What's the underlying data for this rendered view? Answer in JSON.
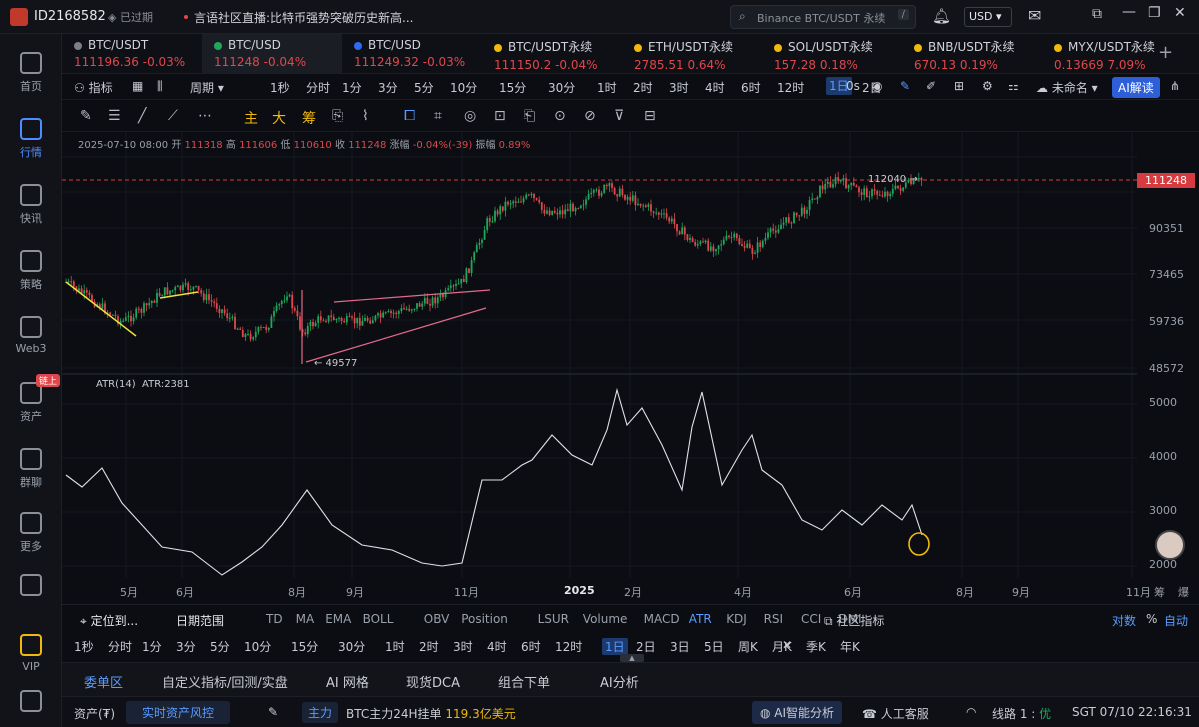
{
  "topbar": {
    "account": "ID2168582",
    "expired": "已过期",
    "news_prefix": "言语社区直播:",
    "news": "比特币强势突破历史新高...",
    "search_placeholder": "Binance BTC/USDT 永续",
    "search_key": "/",
    "currency": "USD"
  },
  "sidebar": [
    {
      "label": "首页",
      "icon": "home-icon"
    },
    {
      "label": "行情",
      "icon": "market-chart-icon",
      "active": true
    },
    {
      "label": "快讯",
      "icon": "news-icon"
    },
    {
      "label": "策略",
      "icon": "robot-icon"
    },
    {
      "label": "Web3",
      "icon": "web3-icon"
    },
    {
      "label": "资产",
      "icon": "wallet-icon",
      "badge": "链上"
    },
    {
      "label": "群聊",
      "icon": "chat-icon"
    },
    {
      "label": "更多",
      "icon": "more-grid-icon"
    },
    {
      "label": "",
      "icon": "phone-icon"
    },
    {
      "label": "VIP",
      "icon": "vip-icon"
    },
    {
      "label": "",
      "icon": "settings-icon"
    }
  ],
  "tickers": [
    {
      "name": "BTC/USDT",
      "price": "111196.36",
      "change": "-0.03%",
      "color": "#7a7f8a"
    },
    {
      "name": "BTC/USD",
      "price": "111248",
      "change": "-0.04%",
      "color": "#1fa85c",
      "active": true
    },
    {
      "name": "BTC/USD",
      "price": "111249.32",
      "change": "-0.03%",
      "color": "#2c6cf0"
    },
    {
      "name": "BTC/USDT永续",
      "price": "111150.2",
      "change": "-0.04%",
      "color": "#f0b90b"
    },
    {
      "name": "ETH/USDT永续",
      "price": "2785.51",
      "change": "0.64%",
      "color": "#f0b90b"
    },
    {
      "name": "SOL/USDT永续",
      "price": "157.28",
      "change": "0.18%",
      "color": "#f0b90b"
    },
    {
      "name": "BNB/USDT永续",
      "price": "670.13",
      "change": "0.19%",
      "color": "#f0b90b"
    },
    {
      "name": "MYX/USDT永续",
      "price": "0.13669",
      "change": "7.09%",
      "color": "#f0b90b"
    }
  ],
  "toolbar1": {
    "indicator": "指标",
    "period": "周期",
    "intervals": [
      "1秒",
      "分时",
      "1分",
      "3分",
      "5分",
      "10分",
      "15分",
      "30分",
      "1时",
      "2时",
      "3时",
      "4时",
      "6时",
      "12时",
      "1日",
      "2日"
    ],
    "active_interval": "1日",
    "seconds": "0s",
    "layout_name": "未命名",
    "ai_label": "AI解读"
  },
  "toolbar2": {
    "labels": [
      "主",
      "大",
      "筹"
    ]
  },
  "ohlc": {
    "date": "2025-07-10 08:00",
    "open_label": "开",
    "open": "111318",
    "high_label": "高",
    "high": "111606",
    "low_label": "低",
    "low": "110610",
    "close_label": "收",
    "close": "111248",
    "chg_label": "涨幅",
    "chg": "-0.04%(-39)",
    "amp_label": "振幅",
    "amp": "0.89%"
  },
  "price_axis": {
    "ticks": [
      "90351",
      "73465",
      "59736",
      "48572"
    ],
    "current": "111248",
    "high_marker": "112040",
    "low_marker": "49577"
  },
  "atr": {
    "title": "ATR(14)",
    "value_label": "ATR:2381",
    "ticks": [
      "5000",
      "4000",
      "3000",
      "2000"
    ]
  },
  "x_axis": {
    "ticks": [
      "5月",
      "6月",
      "8月",
      "9月",
      "11月",
      "2025",
      "2月",
      "4月",
      "6月",
      "8月",
      "9月",
      "11月"
    ],
    "right_label": "筹",
    "right_label2": "爆"
  },
  "indicator_bar": {
    "locate": "定位到...",
    "date_range": "日期范围",
    "items": [
      "TD",
      "MA",
      "EMA",
      "BOLL",
      "OBV",
      "Position",
      "LSUR",
      "Volume",
      "MACD",
      "ATR",
      "KDJ",
      "RSI",
      "CCI",
      "DMI"
    ],
    "active": "ATR",
    "community": "社区指标",
    "log": "对数",
    "pct": "%",
    "auto": "自动"
  },
  "interval_bar": {
    "items": [
      "1秒",
      "分时",
      "1分",
      "3分",
      "5分",
      "10分",
      "15分",
      "30分",
      "1时",
      "2时",
      "3时",
      "4时",
      "6时",
      "12时",
      "1日",
      "2日",
      "3日",
      "5日",
      "周K",
      "月K",
      "季K",
      "年K"
    ],
    "active": "1日"
  },
  "tabs": [
    "委单区",
    "自定义指标/回测/实盘",
    "AI 网格",
    "现货DCA",
    "组合下单",
    "AI分析"
  ],
  "status": {
    "assets": "资产(₮)",
    "risk": "实时资产风控",
    "main_tag": "主力",
    "main_text": "BTC主力24H挂单",
    "main_value": "119.3亿美元",
    "ai_analysis": "AI智能分析",
    "support": "人工客服",
    "line": "线路 1 :",
    "line_state": "优",
    "time": "SGT 07/10 22:16:31"
  }
}
